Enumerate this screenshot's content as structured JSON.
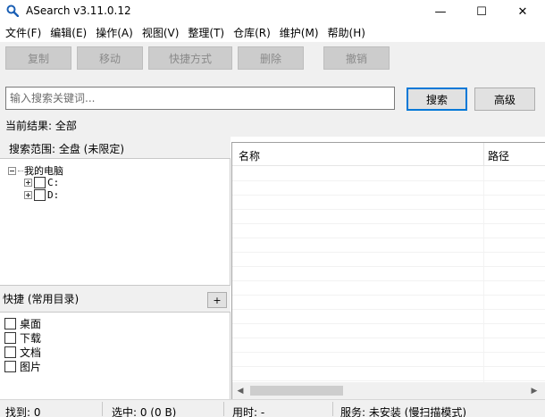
{
  "window": {
    "title": "ASearch v3.11.0.12",
    "app_icon": "magnifier-icon",
    "controls": {
      "minimize": "—",
      "maximize": "☐",
      "close": "✕"
    }
  },
  "menu": [
    "文件(F)",
    "编辑(E)",
    "操作(A)",
    "视图(V)",
    "整理(T)",
    "仓库(R)",
    "维护(M)",
    "帮助(H)"
  ],
  "toolbar": {
    "copy": "复制",
    "move": "移动",
    "shortcut": "快捷方式",
    "delete": "删除",
    "undo": "撤销"
  },
  "search": {
    "placeholder": "输入搜索关键词...",
    "value": "",
    "search_button": "搜索",
    "advanced_button": "高级"
  },
  "current_result": "当前结果: 全部",
  "scope": {
    "label": "搜索范围: 全盘 (未限定)",
    "tree_root": "我的电脑",
    "drives": [
      "C:",
      "D:"
    ]
  },
  "quick": {
    "label": "快捷 (常用目录)",
    "add": "+",
    "items": [
      "桌面",
      "下载",
      "文档",
      "图片"
    ]
  },
  "results": {
    "columns": [
      "名称",
      "路径"
    ],
    "rows": []
  },
  "status": {
    "found": "找到: 0",
    "selected": "选中: 0 (0 B)",
    "time": "用时: -",
    "service": "服务: 未安装 (慢扫描模式)"
  },
  "colors": {
    "accent": "#0078d7",
    "panel_bg": "#f0f0f0",
    "disabled_button_bg": "#cccccc",
    "disabled_text": "#8a8a8a"
  }
}
